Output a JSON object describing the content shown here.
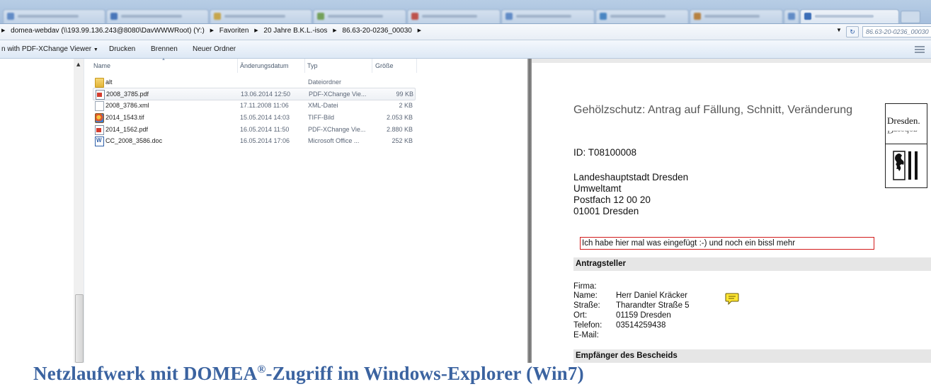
{
  "address_bar": {
    "crumbs": [
      "domea-webdav (\\\\193.99.136.243@8080\\DavWWWRoot) (Y:)",
      "Favoriten",
      "20 Jahre B.K.L.-isos",
      "86.63-20-0236_00030"
    ],
    "search_text": "86.63-20-0236_00030"
  },
  "command_bar": {
    "open_with": "n with PDF-XChange Viewer",
    "print": "Drucken",
    "burn": "Brennen",
    "new_folder": "Neuer Ordner"
  },
  "columns": {
    "name": "Name",
    "date": "Änderungsdatum",
    "type": "Typ",
    "size": "Größe"
  },
  "files": [
    {
      "name": "alt",
      "date": "",
      "type": "Dateiordner",
      "size": "",
      "icon": "folder-icon"
    },
    {
      "name": "2008_3785.pdf",
      "date": "13.06.2014 12:50",
      "type": "PDF-XChange Vie...",
      "size": "99 KB",
      "icon": "pdf-file-icon"
    },
    {
      "name": "2008_3786.xml",
      "date": "17.11.2008 11:06",
      "type": "XML-Datei",
      "size": "2 KB",
      "icon": "xml-file-icon"
    },
    {
      "name": "2014_1543.tif",
      "date": "15.05.2014 14:03",
      "type": "TIFF-Bild",
      "size": "2.053 KB",
      "icon": "tiff-file-icon"
    },
    {
      "name": "2014_1562.pdf",
      "date": "16.05.2014 11:50",
      "type": "PDF-XChange Vie...",
      "size": "2.880 KB",
      "icon": "pdf-file-icon"
    },
    {
      "name": "CC_2008_3586.doc",
      "date": "16.05.2014 17:06",
      "type": "Microsoft Office ...",
      "size": "252 KB",
      "icon": "word-file-icon"
    }
  ],
  "preview": {
    "title": "Gehölzschutz: Antrag auf Fällung, Schnitt, Veränderung",
    "logo_text": "Dresden.",
    "id_line": "ID: T08100008",
    "address": [
      "Landeshauptstadt Dresden",
      "Umweltamt",
      "Postfach 12 00 20",
      "01001 Dresden"
    ],
    "note": "Ich habe hier mal was eingefügt :-) und noch ein bissl mehr",
    "section1": "Antragsteller",
    "firma_label": "Firma:",
    "fields": [
      {
        "label": "Name:",
        "value": "Herr Daniel Kräcker"
      },
      {
        "label": "Straße:",
        "value": "Tharandter Straße 5"
      },
      {
        "label": "Ort:",
        "value": "01159 Dresden"
      },
      {
        "label": "Telefon:",
        "value": "03514259438"
      },
      {
        "label": "E-Mail:",
        "value": ""
      }
    ],
    "section2": "Empfänger des Bescheids"
  },
  "caption": {
    "before": "Netzlaufwerk mit DOMEA",
    "reg": "®",
    "after": "-Zugriff im Windows-Explorer (Win7)"
  }
}
